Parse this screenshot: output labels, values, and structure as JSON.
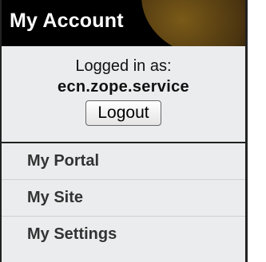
{
  "portlet": {
    "title": "My Account",
    "logged_in_label": "Logged in as:",
    "username": "ecn.zope.service",
    "logout_label": "Logout"
  },
  "nav": {
    "items": [
      {
        "label": "My Portal"
      },
      {
        "label": "My Site"
      },
      {
        "label": "My Settings"
      }
    ]
  },
  "colors": {
    "header_bg": "#000000",
    "header_accent": "#7a5a18",
    "panel_bg": "#ebeced",
    "title_text": "#ffffff"
  }
}
